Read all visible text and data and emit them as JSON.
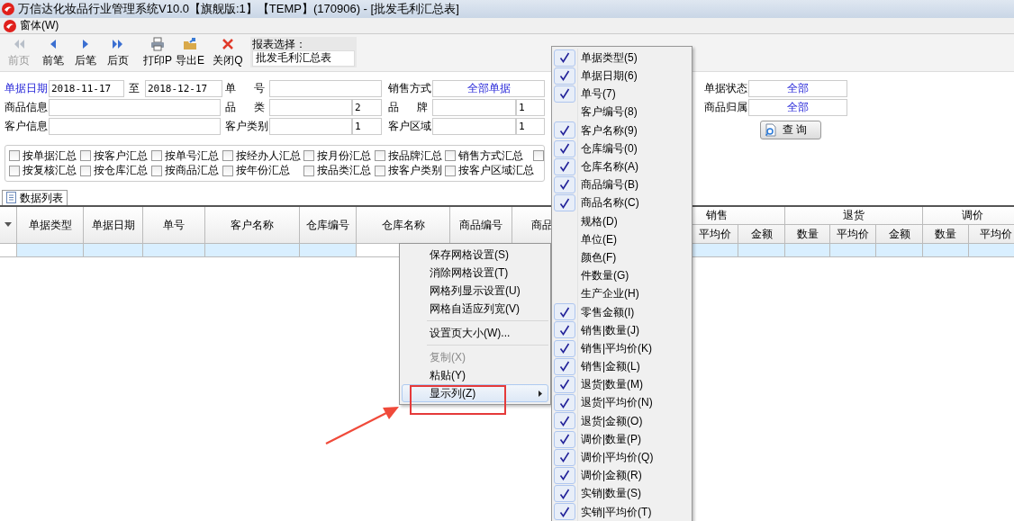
{
  "window": {
    "title": "万信达化妆品行业管理系统V10.0【旗舰版:1】【TEMP】(170906) - [批发毛利汇总表]"
  },
  "menu_bar": [
    {
      "label": "窗体(W)"
    }
  ],
  "toolbar": {
    "buttons": [
      {
        "label": "前页",
        "kind": "first",
        "disabled": true
      },
      {
        "label": "前笔",
        "kind": "prev",
        "disabled": false
      },
      {
        "label": "后笔",
        "kind": "next",
        "disabled": false
      },
      {
        "label": "后页",
        "kind": "last",
        "disabled": false
      },
      {
        "label": "打印P",
        "kind": "print",
        "disabled": false
      },
      {
        "label": "导出E",
        "kind": "export",
        "disabled": false
      },
      {
        "label": "关闭Q",
        "kind": "close",
        "disabled": false
      }
    ],
    "report_selector": {
      "label": "报表选择：",
      "value": "批发毛利汇总表"
    }
  },
  "filters": {
    "rows": [
      [
        {
          "kind": "date_range",
          "label": "单据日期",
          "from": "2018-11-17",
          "separator": "至",
          "to": "2018-12-17"
        },
        {
          "kind": "text",
          "label": "单号"
        },
        {
          "kind": "select",
          "label": "销售方式",
          "value": "全部单据"
        }
      ],
      [
        {
          "kind": "text",
          "label": "商品信息"
        },
        {
          "kind": "pair",
          "label": "品类",
          "code": "2"
        },
        {
          "kind": "pair",
          "label": "品牌",
          "code": "1"
        }
      ],
      [
        {
          "kind": "text",
          "label": "客户信息"
        },
        {
          "kind": "pair",
          "label": "客户类别",
          "code": "1"
        },
        {
          "kind": "pair",
          "label": "客户区域",
          "code": "1"
        }
      ]
    ],
    "right": [
      {
        "label": "单据状态",
        "value": "全部"
      },
      {
        "label": "商品归属",
        "value": "全部"
      }
    ],
    "query_button": "查 询"
  },
  "summaries": [
    [
      {
        "label": "按单据汇总",
        "checked": false
      },
      {
        "label": "按客户汇总",
        "checked": false
      },
      {
        "label": "按单号汇总",
        "checked": false
      },
      {
        "label": "按经办人汇总",
        "checked": false
      },
      {
        "label": "按月份汇总",
        "checked": false
      },
      {
        "label": "按品牌汇总",
        "checked": false
      },
      {
        "label": "销售方式汇总",
        "checked": false
      },
      {
        "checked": false
      }
    ],
    [
      {
        "label": "按复核汇总",
        "checked": false
      },
      {
        "label": "按仓库汇总",
        "checked": false
      },
      {
        "label": "按商品汇总",
        "checked": false
      },
      {
        "label": "按年份汇总",
        "checked": false
      },
      {
        "label": "按品类汇总",
        "checked": false
      },
      {
        "label": "按客户类别",
        "checked": false
      },
      {
        "label": "按客户区域汇总",
        "checked": false
      }
    ]
  ],
  "grid": {
    "tab": "数据列表",
    "columns": [
      "单据类型",
      "单据日期",
      "单号",
      "客户名称",
      "仓库编号",
      "仓库名称",
      "商品编号",
      "商品"
    ],
    "groups": [
      {
        "label": "销售",
        "subcolumns": [
          "平均价",
          "金额"
        ]
      },
      {
        "label": "退货",
        "subcolumns": [
          "数量",
          "平均价",
          "金额"
        ]
      },
      {
        "label": "调价",
        "subcolumns": [
          "数量",
          "平均价"
        ]
      }
    ]
  },
  "context_menu": {
    "items": [
      {
        "kind": "item",
        "label": "保存网格设置(S)",
        "disabled": false,
        "selected": false
      },
      {
        "kind": "item",
        "label": "消除网格设置(T)",
        "disabled": false,
        "selected": false
      },
      {
        "kind": "item",
        "label": "网格列显示设置(U)",
        "disabled": false,
        "selected": false
      },
      {
        "kind": "item",
        "label": "网格自适应列宽(V)",
        "disabled": false,
        "selected": false
      },
      {
        "kind": "separator"
      },
      {
        "kind": "item",
        "label": "设置页大小(W)...",
        "disabled": false,
        "selected": false
      },
      {
        "kind": "separator"
      },
      {
        "kind": "item",
        "label": "复制(X)",
        "disabled": true,
        "selected": false
      },
      {
        "kind": "item",
        "label": "粘贴(Y)",
        "disabled": false,
        "selected": false
      },
      {
        "kind": "submenu",
        "label": "显示列(Z)",
        "disabled": false,
        "selected": true
      }
    ]
  },
  "column_menu": {
    "items": [
      {
        "label": "单据类型(5)",
        "checked": true
      },
      {
        "label": "单据日期(6)",
        "checked": true
      },
      {
        "label": "单号(7)",
        "checked": true
      },
      {
        "label": "客户编号(8)",
        "checked": false
      },
      {
        "label": "客户名称(9)",
        "checked": true
      },
      {
        "label": "仓库编号(0)",
        "checked": true
      },
      {
        "label": "仓库名称(A)",
        "checked": true
      },
      {
        "label": "商品编号(B)",
        "checked": true
      },
      {
        "label": "商品名称(C)",
        "checked": true
      },
      {
        "label": "规格(D)",
        "checked": false
      },
      {
        "label": "单位(E)",
        "checked": false
      },
      {
        "label": "颜色(F)",
        "checked": false
      },
      {
        "label": "件数量(G)",
        "checked": false
      },
      {
        "label": "生产企业(H)",
        "checked": false
      },
      {
        "label": "零售金额(I)",
        "checked": true
      },
      {
        "label": "销售|数量(J)",
        "checked": true
      },
      {
        "label": "销售|平均价(K)",
        "checked": true
      },
      {
        "label": "销售|金额(L)",
        "checked": true
      },
      {
        "label": "退货|数量(M)",
        "checked": true
      },
      {
        "label": "退货|平均价(N)",
        "checked": true
      },
      {
        "label": "退货|金额(O)",
        "checked": true
      },
      {
        "label": "调价|数量(P)",
        "checked": true
      },
      {
        "label": "调价|平均价(Q)",
        "checked": true
      },
      {
        "label": "调价|金额(R)",
        "checked": true
      },
      {
        "label": "实销|数量(S)",
        "checked": true
      },
      {
        "label": "实销|平均价(T)",
        "checked": true
      }
    ]
  }
}
